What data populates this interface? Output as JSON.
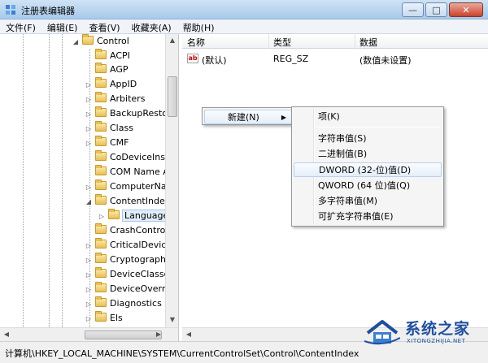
{
  "window": {
    "title": "注册表编辑器",
    "controls": {
      "minimize": "—",
      "maximize": "□",
      "close": "✕"
    }
  },
  "menubar": [
    "文件(F)",
    "编辑(E)",
    "查看(V)",
    "收藏夹(A)",
    "帮助(H)"
  ],
  "tree": {
    "parent": "Control",
    "items": [
      "ACPI",
      "AGP",
      "AppID",
      "Arbiters",
      "BackupRestor",
      "Class",
      "CMF",
      "CoDeviceInsta",
      "COM Name A",
      "ComputerNar",
      "ContentIndex"
    ],
    "selected_child": "Language",
    "items_after": [
      "CrashControl",
      "CriticalDeviceI",
      "Cryptography",
      "DeviceClasses",
      "DeviceOverric",
      "Diagnostics",
      "Els"
    ]
  },
  "list": {
    "headers": {
      "name": "名称",
      "type": "类型",
      "data": "数据"
    },
    "rows": [
      {
        "icon": "ab",
        "name": "(默认)",
        "type": "REG_SZ",
        "data": "(数值未设置)"
      }
    ]
  },
  "context_menu": {
    "new_label": "新建(N)",
    "submenu": [
      "项(K)",
      "字符串值(S)",
      "二进制值(B)",
      "DWORD (32-位)值(D)",
      "QWORD (64 位)值(Q)",
      "多字符串值(M)",
      "可扩充字符串值(E)"
    ],
    "highlighted_index": 3
  },
  "statusbar": {
    "path": "计算机\\HKEY_LOCAL_MACHINE\\SYSTEM\\CurrentControlSet\\Control\\ContentIndex"
  },
  "watermark": {
    "text": "系统之家",
    "sub": "XITONGZHIJIA.NET"
  },
  "colors": {
    "titlebar": "#a9c9ea",
    "highlight": "#e4eef9",
    "watermark": "#1f4f9c"
  }
}
